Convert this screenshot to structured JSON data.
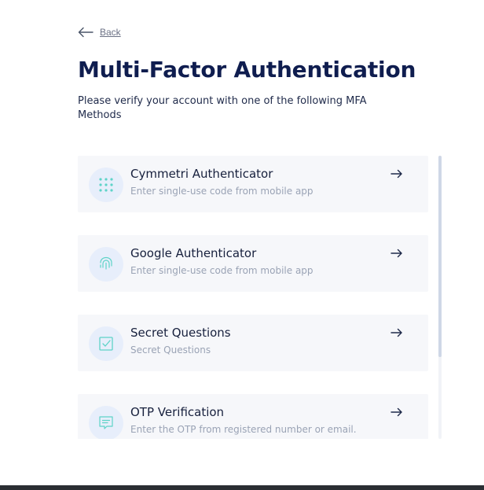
{
  "back": {
    "label": "Back",
    "icon": "arrow-left-icon"
  },
  "header": {
    "title": "Multi-Factor Authentication",
    "subtitle": "Please verify your account with one of the following MFA Methods"
  },
  "colors": {
    "title": "#0f1d4f",
    "card_bg": "#f6f7fa",
    "icon_circle_bg": "#e7eefb",
    "icon_accent": "#5ed3c8",
    "bottom_bar": "#2b2e33"
  },
  "methods": [
    {
      "name": "Cymmetri Authenticator",
      "description": "Enter single-use code from mobile app",
      "icon": "dots-grid-icon"
    },
    {
      "name": "Google Authenticator",
      "description": "Enter single-use code from mobile app",
      "icon": "fingerprint-icon"
    },
    {
      "name": "Secret Questions",
      "description": "Secret Questions",
      "icon": "checkbox-icon"
    },
    {
      "name": "OTP Verification",
      "description": "Enter the OTP from registered number or email.",
      "icon": "chat-message-icon"
    }
  ]
}
